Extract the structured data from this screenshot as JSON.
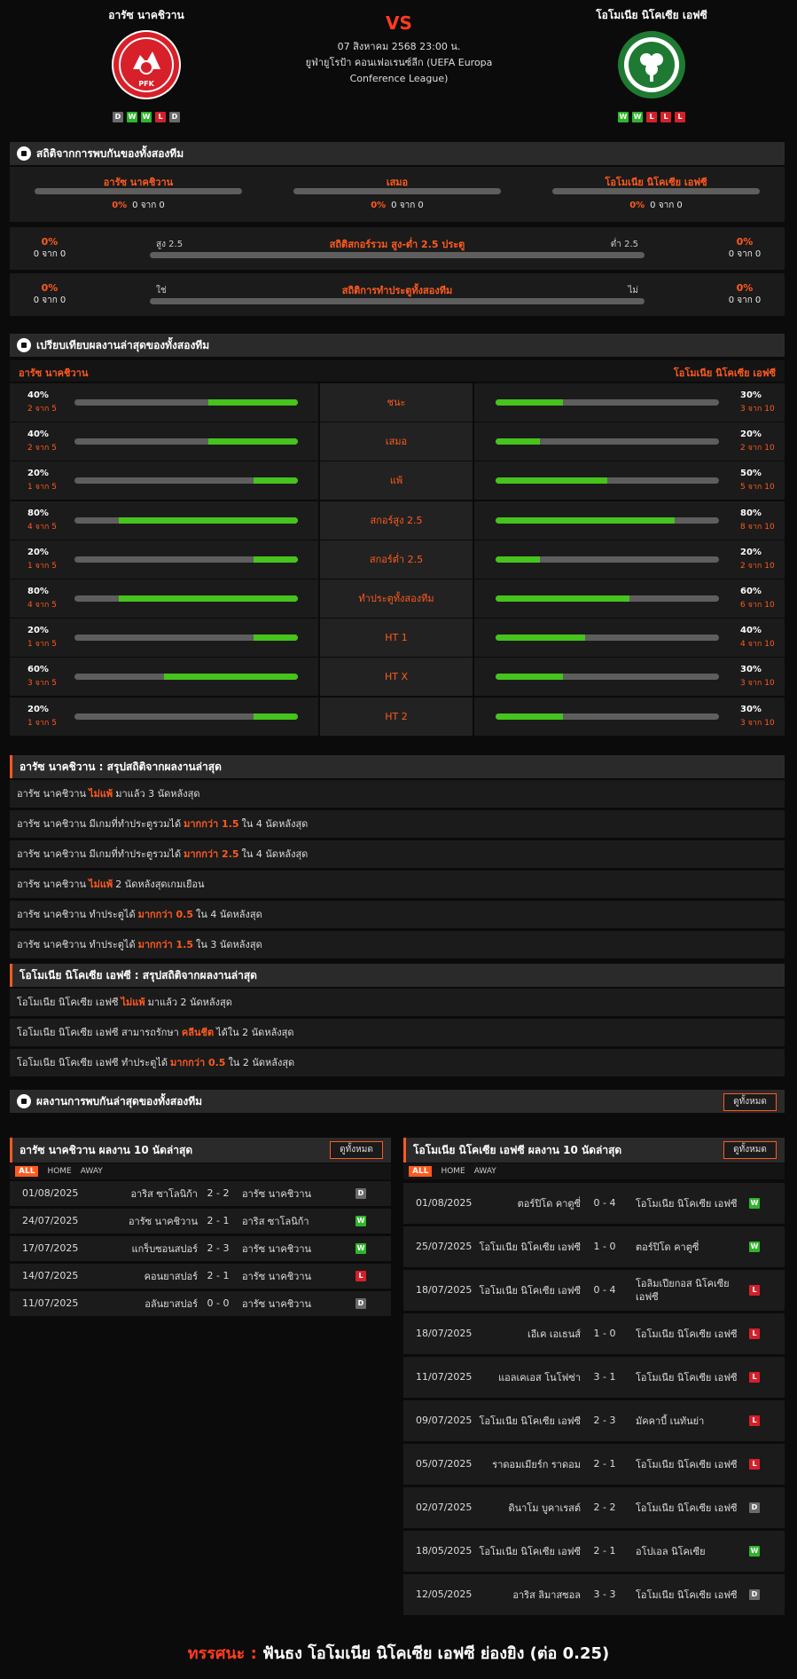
{
  "match": {
    "home": "อารัซ นาคชิวาน",
    "away": "โอโมเนีย นิโคเซีย เอฟซี",
    "vs": "VS",
    "date": "07 สิงหาคม 2568 23:00 น.",
    "competition_line1": "ยูฟ่ายูโรป้า คอนเฟอเรนซ์ลีก (UEFA Europa",
    "competition_line2": "Conference League)",
    "home_logo_text": "PFK",
    "home_form": [
      "D",
      "W",
      "W",
      "L",
      "D"
    ],
    "away_form": [
      "W",
      "W",
      "L",
      "L",
      "L"
    ]
  },
  "colors": {
    "accent": "#ff5a1f",
    "win": "#2fb52b",
    "loss": "#d4202a",
    "draw": "#6a6a6a",
    "bar_fill": "#46c31c"
  },
  "h2h": {
    "title": "สถิติจากการพบกันของทั้งสองทีม",
    "cols": [
      {
        "label": "อารัซ นาคชิวาน",
        "pct": "0%",
        "count": "0 จาก 0"
      },
      {
        "label": "เสมอ",
        "pct": "0%",
        "count": "0 จาก 0"
      },
      {
        "label": "โอโมเนีย นิโคเซีย เอฟซี",
        "pct": "0%",
        "count": "0 จาก 0"
      }
    ],
    "ou": {
      "title": "สถิติสกอร์รวม สูง-ต่ำ 2.5 ประตู",
      "left_label": "สูง 2.5",
      "right_label": "ต่ำ 2.5",
      "left_pct": "0%",
      "left_count": "0 จาก 0",
      "right_pct": "0%",
      "right_count": "0 จาก 0"
    },
    "btts": {
      "title": "สถิติการทำประตูทั้งสองทีม",
      "left_label": "ใช่",
      "right_label": "ไม่",
      "left_pct": "0%",
      "left_count": "0 จาก 0",
      "right_pct": "0%",
      "right_count": "0 จาก 0"
    }
  },
  "compare": {
    "title": "เปรียบเทียบผลงานล่าสุดของทั้งสองทีม",
    "home": "อารัซ นาคชิวาน",
    "away": "โอโมเนีย นิโคเซีย เอฟซี",
    "rows": [
      {
        "label": "ชนะ",
        "hp": "40%",
        "hc": "2 จาก 5",
        "hv": 0.4,
        "ap": "30%",
        "ac": "3 จาก 10",
        "av": 0.3
      },
      {
        "label": "เสมอ",
        "hp": "40%",
        "hc": "2 จาก 5",
        "hv": 0.4,
        "ap": "20%",
        "ac": "2 จาก 10",
        "av": 0.2
      },
      {
        "label": "แพ้",
        "hp": "20%",
        "hc": "1 จาก 5",
        "hv": 0.2,
        "ap": "50%",
        "ac": "5 จาก 10",
        "av": 0.5
      },
      {
        "label": "สกอร์สูง 2.5",
        "hp": "80%",
        "hc": "4 จาก 5",
        "hv": 0.8,
        "ap": "80%",
        "ac": "8 จาก 10",
        "av": 0.8
      },
      {
        "label": "สกอร์ต่ำ 2.5",
        "hp": "20%",
        "hc": "1 จาก 5",
        "hv": 0.2,
        "ap": "20%",
        "ac": "2 จาก 10",
        "av": 0.2
      },
      {
        "label": "ทำประตูทั้งสองทีม",
        "hp": "80%",
        "hc": "4 จาก 5",
        "hv": 0.8,
        "ap": "60%",
        "ac": "6 จาก 10",
        "av": 0.6
      },
      {
        "label": "HT 1",
        "hp": "20%",
        "hc": "1 จาก 5",
        "hv": 0.2,
        "ap": "40%",
        "ac": "4 จาก 10",
        "av": 0.4
      },
      {
        "label": "HT X",
        "hp": "60%",
        "hc": "3 จาก 5",
        "hv": 0.6,
        "ap": "30%",
        "ac": "3 จาก 10",
        "av": 0.3
      },
      {
        "label": "HT 2",
        "hp": "20%",
        "hc": "1 จาก 5",
        "hv": 0.2,
        "ap": "30%",
        "ac": "3 จาก 10",
        "av": 0.3
      }
    ]
  },
  "home_summary": {
    "title": "อารัซ นาคชิวาน : สรุปสถิติจากผลงานล่าสุด",
    "rows": [
      {
        "pre": "อารัซ นาคชิวาน",
        "key": "ไม่แพ้",
        "post": "มาแล้ว 3 นัดหลังสุด"
      },
      {
        "pre": "อารัซ นาคชิวาน มีเกมที่ทำประตูรวมได้",
        "key": "มากกว่า 1.5",
        "post": "ใน 4 นัดหลังสุด"
      },
      {
        "pre": "อารัซ นาคชิวาน มีเกมที่ทำประตูรวมได้",
        "key": "มากกว่า 2.5",
        "post": "ใน 4 นัดหลังสุด"
      },
      {
        "pre": "อารัซ นาคชิวาน",
        "key": "ไม่แพ้",
        "post": "2 นัดหลังสุดเกมเยือน"
      },
      {
        "pre": "อารัซ นาคชิวาน ทำประตูได้",
        "key": "มากกว่า 0.5",
        "post": "ใน 4 นัดหลังสุด"
      },
      {
        "pre": "อารัซ นาคชิวาน ทำประตูได้",
        "key": "มากกว่า 1.5",
        "post": "ใน 3 นัดหลังสุด"
      }
    ]
  },
  "away_summary": {
    "title": "โอโมเนีย นิโคเซีย เอฟซี : สรุปสถิติจากผลงานล่าสุด",
    "rows": [
      {
        "pre": "โอโมเนีย นิโคเซีย เอฟซี",
        "key": "ไม่แพ้",
        "post": "มาแล้ว 2 นัดหลังสุด"
      },
      {
        "pre": "โอโมเนีย นิโคเซีย เอฟซี สามารถรักษา",
        "key": "คลีนชีต",
        "post": "ได้ใน 2 นัดหลังสุด"
      },
      {
        "pre": "โอโมเนีย นิโคเซีย เอฟซี ทำประตูได้",
        "key": "มากกว่า 0.5",
        "post": "ใน 2 นัดหลังสุด"
      }
    ]
  },
  "recent": {
    "title": "ผลงานการพบกันล่าสุดของทั้งสองทีม",
    "view_all": "ดูทั้งหมด",
    "tabs": [
      "ALL",
      "HOME",
      "AWAY"
    ],
    "home_title": "อารัซ นาคชิวาน ผลงาน 10 นัดล่าสุด",
    "away_title": "โอโมเนีย นิโคเซีย เอฟซี ผลงาน 10 นัดล่าสุด",
    "home_rows": [
      {
        "date": "01/08/2025",
        "home": "อาริส ซาโลนิก้า",
        "score": "2 - 2",
        "away": "อารัซ นาคชิวาน",
        "res": "D"
      },
      {
        "date": "24/07/2025",
        "home": "อารัซ นาคชิวาน",
        "score": "2 - 1",
        "away": "อาริส ซาโลนิก้า",
        "res": "W"
      },
      {
        "date": "17/07/2025",
        "home": "แกร็บซอนสปอร์",
        "score": "2 - 3",
        "away": "อารัซ นาคชิวาน",
        "res": "W"
      },
      {
        "date": "14/07/2025",
        "home": "คอนยาสปอร์",
        "score": "2 - 1",
        "away": "อารัซ นาคชิวาน",
        "res": "L"
      },
      {
        "date": "11/07/2025",
        "home": "อลันยาสปอร์",
        "score": "0 - 0",
        "away": "อารัซ นาคชิวาน",
        "res": "D"
      }
    ],
    "away_rows": [
      {
        "date": "01/08/2025",
        "home": "ตอร์ปิโด คาตูซี่",
        "score": "0 - 4",
        "away": "โอโมเนีย นิโคเซีย เอฟซี",
        "res": "W"
      },
      {
        "date": "25/07/2025",
        "home": "โอโมเนีย นิโคเซีย เอฟซี",
        "score": "1 - 0",
        "away": "ตอร์ปิโด คาตูซี่",
        "res": "W"
      },
      {
        "date": "18/07/2025",
        "home": "โอโมเนีย นิโคเซีย เอฟซี",
        "score": "0 - 4",
        "away": "โอลิมเปียกอส นิโคเซีย เอฟซี",
        "res": "L"
      },
      {
        "date": "18/07/2025",
        "home": "เอีเค เอเธนส์",
        "score": "1 - 0",
        "away": "โอโมเนีย นิโคเซีย เอฟซี",
        "res": "L"
      },
      {
        "date": "11/07/2025",
        "home": "แอลเคเอส โนโฟซ่า",
        "score": "3 - 1",
        "away": "โอโมเนีย นิโคเซีย เอฟซี",
        "res": "L"
      },
      {
        "date": "09/07/2025",
        "home": "โอโมเนีย นิโคเซีย เอฟซี",
        "score": "2 - 3",
        "away": "มัคคาบี้ เนทันย่า",
        "res": "L"
      },
      {
        "date": "05/07/2025",
        "home": "ราดอมเมียร์ก ราดอม",
        "score": "2 - 1",
        "away": "โอโมเนีย นิโคเซีย เอฟซี",
        "res": "L"
      },
      {
        "date": "02/07/2025",
        "home": "ดินาโม บูคาเรสต์",
        "score": "2 - 2",
        "away": "โอโมเนีย นิโคเซีย เอฟซี",
        "res": "D"
      },
      {
        "date": "18/05/2025",
        "home": "โอโมเนีย นิโคเซีย เอฟซี",
        "score": "2 - 1",
        "away": "อโปเอล นิโคเซีย",
        "res": "W"
      },
      {
        "date": "12/05/2025",
        "home": "อาริส ลิมาสซอล",
        "score": "3 - 3",
        "away": "โอโมเนีย นิโคเซีย เอฟซี",
        "res": "D"
      }
    ]
  },
  "verdict": {
    "label": "ทรรศนะ :",
    "text": "ฟันธง โอโมเนีย นิโคเซีย เอฟซี ย่องยิง (ต่อ 0.25)"
  }
}
